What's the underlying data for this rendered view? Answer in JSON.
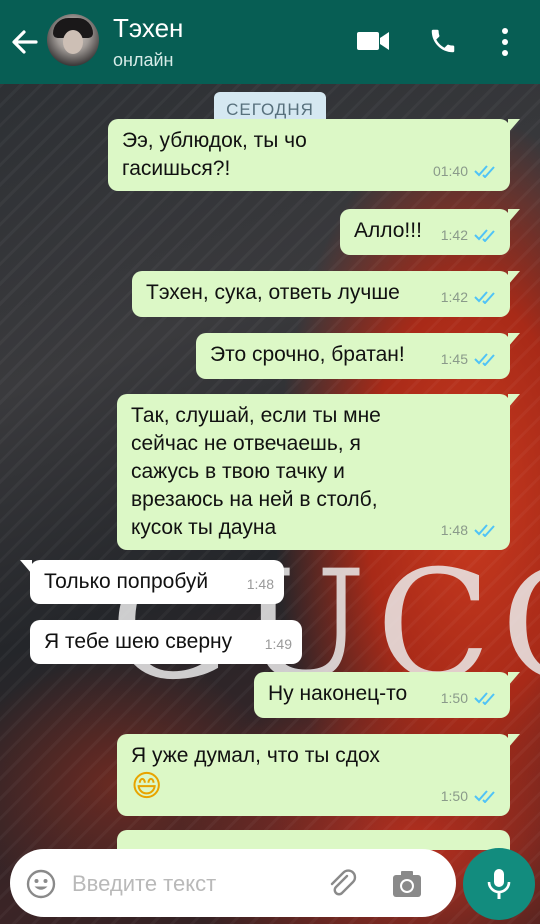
{
  "header": {
    "contact_name": "Тэхен",
    "status": "онлайн",
    "icons": [
      "back-arrow-icon",
      "video-call-icon",
      "phone-icon",
      "more-vert-icon"
    ]
  },
  "chat": {
    "date_label": "СЕГОДНЯ",
    "wallpaper_text": "GUCCI",
    "messages": [
      {
        "dir": "out",
        "text": "Ээ, ублюдок, ты чо\nгасишься?!",
        "time": "01:40",
        "read": true
      },
      {
        "dir": "out",
        "text": "Алло!!!",
        "time": "1:42",
        "read": true
      },
      {
        "dir": "out",
        "text": "Тэхен, сука, ответь лучше",
        "time": "1:42",
        "read": true
      },
      {
        "dir": "out",
        "text": "Это срочно, братан!",
        "time": "1:45",
        "read": true
      },
      {
        "dir": "out",
        "text": "Так, слушай, если ты мне\nсейчас не отвечаешь, я\nсажусь в твою тачку и\nврезаюсь на ней в столб,\nкусок ты дауна",
        "time": "1:48",
        "read": true
      },
      {
        "dir": "in",
        "text": "Только попробуй",
        "time": "1:48"
      },
      {
        "dir": "in",
        "text": "Я тебе шею сверну",
        "time": "1:49"
      },
      {
        "dir": "out",
        "text": "Ну наконец-то",
        "time": "1:50",
        "read": true
      },
      {
        "dir": "out",
        "text": "Я уже думал, что ты сдох",
        "emoji": "😄",
        "time": "1:50",
        "read": true
      }
    ]
  },
  "composer": {
    "placeholder": "Введите текст",
    "icons": [
      "emoji-icon",
      "attach-icon",
      "camera-icon",
      "mic-icon"
    ]
  },
  "colors": {
    "header": "#075e54",
    "outgoing_bubble": "#dcf8c6",
    "incoming_bubble": "#ffffff",
    "read_ticks": "#4fc3f7",
    "mic_button": "#128c7e"
  }
}
